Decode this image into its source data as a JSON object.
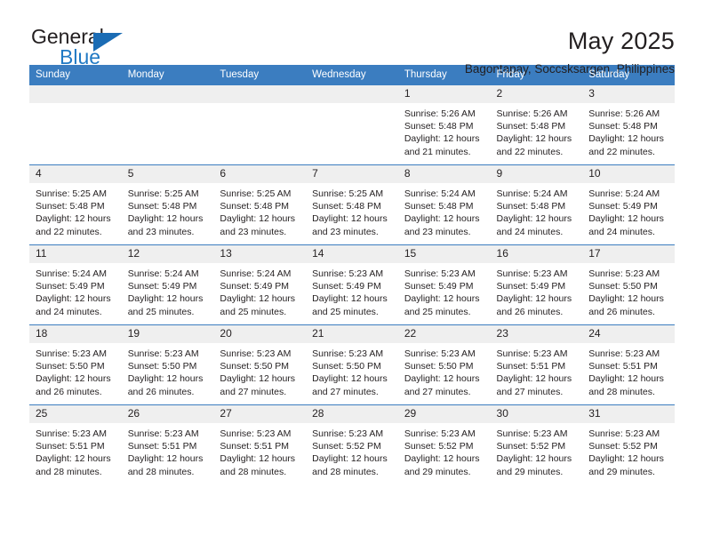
{
  "brand": {
    "name_top": "General",
    "name_bottom": "Blue",
    "accent_color": "#1b6cb4"
  },
  "header": {
    "month_title": "May 2025",
    "location": "Bagontapay, Soccsksargen, Philippines"
  },
  "calendar": {
    "header_bg": "#3b7dc0",
    "daynum_bg": "#efefef",
    "weekday_headers": [
      "Sunday",
      "Monday",
      "Tuesday",
      "Wednesday",
      "Thursday",
      "Friday",
      "Saturday"
    ],
    "weeks": [
      [
        {
          "day": "",
          "empty": true
        },
        {
          "day": "",
          "empty": true
        },
        {
          "day": "",
          "empty": true
        },
        {
          "day": "",
          "empty": true
        },
        {
          "day": "1",
          "sunrise": "Sunrise: 5:26 AM",
          "sunset": "Sunset: 5:48 PM",
          "daylight1": "Daylight: 12 hours",
          "daylight2": "and 21 minutes."
        },
        {
          "day": "2",
          "sunrise": "Sunrise: 5:26 AM",
          "sunset": "Sunset: 5:48 PM",
          "daylight1": "Daylight: 12 hours",
          "daylight2": "and 22 minutes."
        },
        {
          "day": "3",
          "sunrise": "Sunrise: 5:26 AM",
          "sunset": "Sunset: 5:48 PM",
          "daylight1": "Daylight: 12 hours",
          "daylight2": "and 22 minutes."
        }
      ],
      [
        {
          "day": "4",
          "sunrise": "Sunrise: 5:25 AM",
          "sunset": "Sunset: 5:48 PM",
          "daylight1": "Daylight: 12 hours",
          "daylight2": "and 22 minutes."
        },
        {
          "day": "5",
          "sunrise": "Sunrise: 5:25 AM",
          "sunset": "Sunset: 5:48 PM",
          "daylight1": "Daylight: 12 hours",
          "daylight2": "and 23 minutes."
        },
        {
          "day": "6",
          "sunrise": "Sunrise: 5:25 AM",
          "sunset": "Sunset: 5:48 PM",
          "daylight1": "Daylight: 12 hours",
          "daylight2": "and 23 minutes."
        },
        {
          "day": "7",
          "sunrise": "Sunrise: 5:25 AM",
          "sunset": "Sunset: 5:48 PM",
          "daylight1": "Daylight: 12 hours",
          "daylight2": "and 23 minutes."
        },
        {
          "day": "8",
          "sunrise": "Sunrise: 5:24 AM",
          "sunset": "Sunset: 5:48 PM",
          "daylight1": "Daylight: 12 hours",
          "daylight2": "and 23 minutes."
        },
        {
          "day": "9",
          "sunrise": "Sunrise: 5:24 AM",
          "sunset": "Sunset: 5:48 PM",
          "daylight1": "Daylight: 12 hours",
          "daylight2": "and 24 minutes."
        },
        {
          "day": "10",
          "sunrise": "Sunrise: 5:24 AM",
          "sunset": "Sunset: 5:49 PM",
          "daylight1": "Daylight: 12 hours",
          "daylight2": "and 24 minutes."
        }
      ],
      [
        {
          "day": "11",
          "sunrise": "Sunrise: 5:24 AM",
          "sunset": "Sunset: 5:49 PM",
          "daylight1": "Daylight: 12 hours",
          "daylight2": "and 24 minutes."
        },
        {
          "day": "12",
          "sunrise": "Sunrise: 5:24 AM",
          "sunset": "Sunset: 5:49 PM",
          "daylight1": "Daylight: 12 hours",
          "daylight2": "and 25 minutes."
        },
        {
          "day": "13",
          "sunrise": "Sunrise: 5:24 AM",
          "sunset": "Sunset: 5:49 PM",
          "daylight1": "Daylight: 12 hours",
          "daylight2": "and 25 minutes."
        },
        {
          "day": "14",
          "sunrise": "Sunrise: 5:23 AM",
          "sunset": "Sunset: 5:49 PM",
          "daylight1": "Daylight: 12 hours",
          "daylight2": "and 25 minutes."
        },
        {
          "day": "15",
          "sunrise": "Sunrise: 5:23 AM",
          "sunset": "Sunset: 5:49 PM",
          "daylight1": "Daylight: 12 hours",
          "daylight2": "and 25 minutes."
        },
        {
          "day": "16",
          "sunrise": "Sunrise: 5:23 AM",
          "sunset": "Sunset: 5:49 PM",
          "daylight1": "Daylight: 12 hours",
          "daylight2": "and 26 minutes."
        },
        {
          "day": "17",
          "sunrise": "Sunrise: 5:23 AM",
          "sunset": "Sunset: 5:50 PM",
          "daylight1": "Daylight: 12 hours",
          "daylight2": "and 26 minutes."
        }
      ],
      [
        {
          "day": "18",
          "sunrise": "Sunrise: 5:23 AM",
          "sunset": "Sunset: 5:50 PM",
          "daylight1": "Daylight: 12 hours",
          "daylight2": "and 26 minutes."
        },
        {
          "day": "19",
          "sunrise": "Sunrise: 5:23 AM",
          "sunset": "Sunset: 5:50 PM",
          "daylight1": "Daylight: 12 hours",
          "daylight2": "and 26 minutes."
        },
        {
          "day": "20",
          "sunrise": "Sunrise: 5:23 AM",
          "sunset": "Sunset: 5:50 PM",
          "daylight1": "Daylight: 12 hours",
          "daylight2": "and 27 minutes."
        },
        {
          "day": "21",
          "sunrise": "Sunrise: 5:23 AM",
          "sunset": "Sunset: 5:50 PM",
          "daylight1": "Daylight: 12 hours",
          "daylight2": "and 27 minutes."
        },
        {
          "day": "22",
          "sunrise": "Sunrise: 5:23 AM",
          "sunset": "Sunset: 5:50 PM",
          "daylight1": "Daylight: 12 hours",
          "daylight2": "and 27 minutes."
        },
        {
          "day": "23",
          "sunrise": "Sunrise: 5:23 AM",
          "sunset": "Sunset: 5:51 PM",
          "daylight1": "Daylight: 12 hours",
          "daylight2": "and 27 minutes."
        },
        {
          "day": "24",
          "sunrise": "Sunrise: 5:23 AM",
          "sunset": "Sunset: 5:51 PM",
          "daylight1": "Daylight: 12 hours",
          "daylight2": "and 28 minutes."
        }
      ],
      [
        {
          "day": "25",
          "sunrise": "Sunrise: 5:23 AM",
          "sunset": "Sunset: 5:51 PM",
          "daylight1": "Daylight: 12 hours",
          "daylight2": "and 28 minutes."
        },
        {
          "day": "26",
          "sunrise": "Sunrise: 5:23 AM",
          "sunset": "Sunset: 5:51 PM",
          "daylight1": "Daylight: 12 hours",
          "daylight2": "and 28 minutes."
        },
        {
          "day": "27",
          "sunrise": "Sunrise: 5:23 AM",
          "sunset": "Sunset: 5:51 PM",
          "daylight1": "Daylight: 12 hours",
          "daylight2": "and 28 minutes."
        },
        {
          "day": "28",
          "sunrise": "Sunrise: 5:23 AM",
          "sunset": "Sunset: 5:52 PM",
          "daylight1": "Daylight: 12 hours",
          "daylight2": "and 28 minutes."
        },
        {
          "day": "29",
          "sunrise": "Sunrise: 5:23 AM",
          "sunset": "Sunset: 5:52 PM",
          "daylight1": "Daylight: 12 hours",
          "daylight2": "and 29 minutes."
        },
        {
          "day": "30",
          "sunrise": "Sunrise: 5:23 AM",
          "sunset": "Sunset: 5:52 PM",
          "daylight1": "Daylight: 12 hours",
          "daylight2": "and 29 minutes."
        },
        {
          "day": "31",
          "sunrise": "Sunrise: 5:23 AM",
          "sunset": "Sunset: 5:52 PM",
          "daylight1": "Daylight: 12 hours",
          "daylight2": "and 29 minutes."
        }
      ]
    ]
  }
}
